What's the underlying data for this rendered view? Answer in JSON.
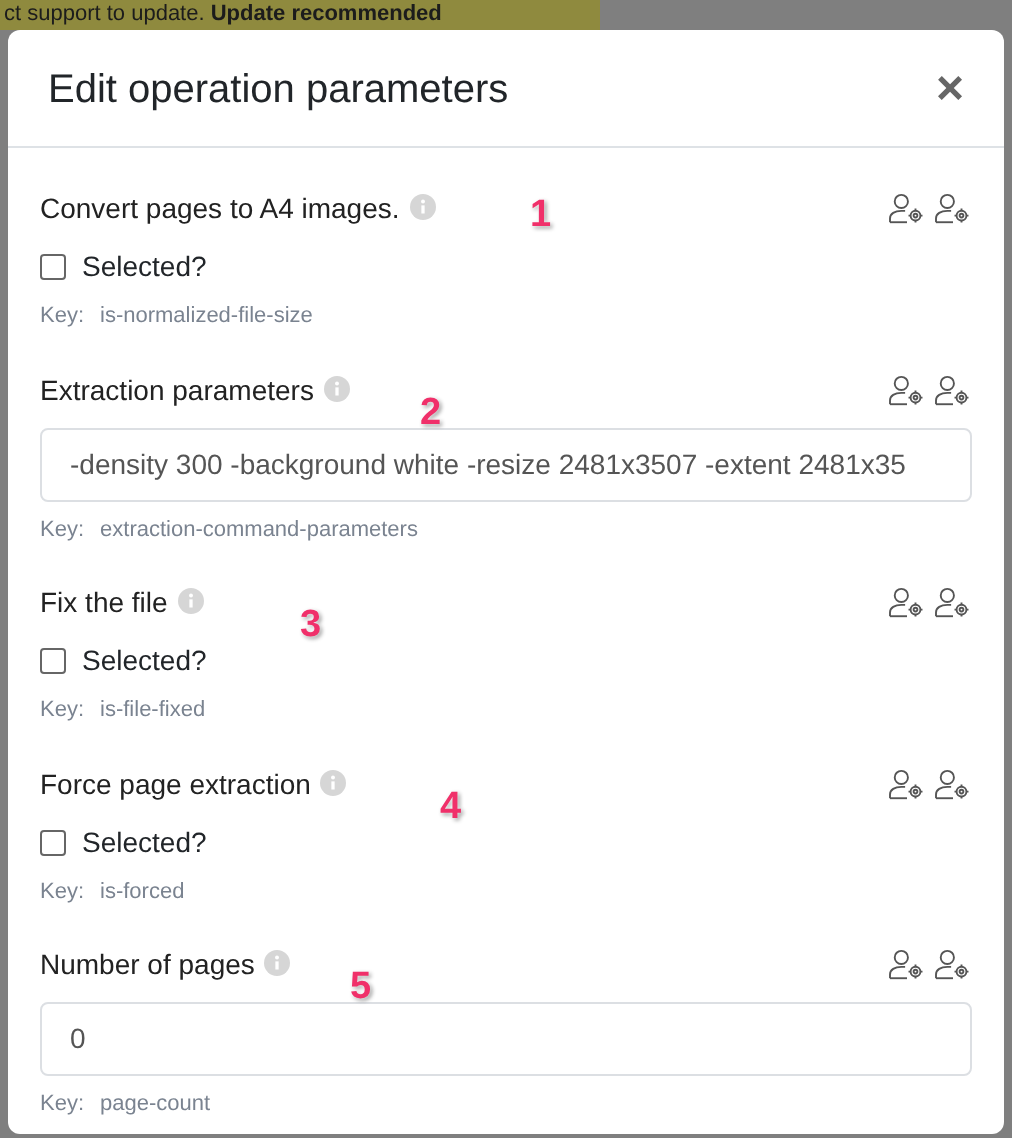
{
  "banner": {
    "text": "ct support to update. **Update recommended**"
  },
  "modal": {
    "title": "Edit operation parameters",
    "close": "×"
  },
  "fields": [
    {
      "kind": "checkbox",
      "label": "Convert pages to A4 images.",
      "checkbox_label": "Selected?",
      "checked": false,
      "key_label": "Key:",
      "key": "is-normalized-file-size",
      "marker": "1"
    },
    {
      "kind": "text",
      "label": "Extraction parameters",
      "value": "-density 300 -background white -resize 2481x3507 -extent 2481x35",
      "key_label": "Key:",
      "key": "extraction-command-parameters",
      "marker": "2"
    },
    {
      "kind": "checkbox",
      "label": "Fix the file",
      "checkbox_label": "Selected?",
      "checked": false,
      "key_label": "Key:",
      "key": "is-file-fixed",
      "marker": "3"
    },
    {
      "kind": "checkbox",
      "label": "Force page extraction",
      "checkbox_label": "Selected?",
      "checked": false,
      "key_label": "Key:",
      "key": "is-forced",
      "marker": "4"
    },
    {
      "kind": "text",
      "label": "Number of pages",
      "value": "0",
      "key_label": "Key:",
      "key": "page-count",
      "marker": "5"
    }
  ]
}
